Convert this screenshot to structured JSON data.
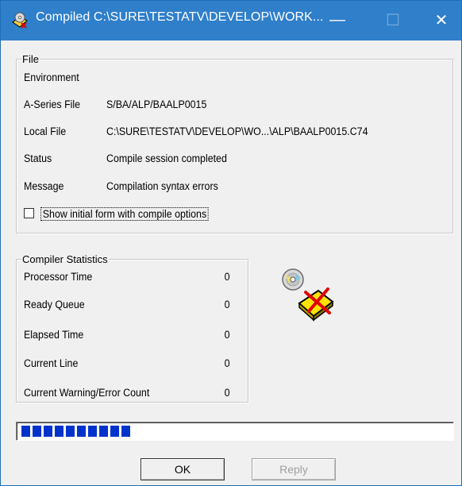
{
  "window": {
    "title": "Compiled C:\\SURE\\TESTATV\\DEVELOP\\WORK...",
    "controls": {
      "minimize": "—",
      "maximize": "☐",
      "close": "✕"
    }
  },
  "file_group": {
    "legend": "File",
    "rows": [
      {
        "label": "Environment",
        "value": ""
      },
      {
        "label": "A-Series File",
        "value": "S/BA/ALP/BAALP0015"
      },
      {
        "label": "Local File",
        "value": "C:\\SURE\\TESTATV\\DEVELOP\\WO...\\ALP\\BAALP0015.C74"
      },
      {
        "label": "Status",
        "value": "Compile session completed"
      },
      {
        "label": "Message",
        "value": "Compilation syntax errors"
      }
    ],
    "show_initial_form": {
      "label": "Show initial form with compile options",
      "checked": false
    }
  },
  "stats_group": {
    "legend": "Compiler Statistics",
    "rows": [
      {
        "label": "Processor Time",
        "value": "0"
      },
      {
        "label": "Ready Queue",
        "value": "0"
      },
      {
        "label": "Elapsed Time",
        "value": "0"
      },
      {
        "label": "Current Line",
        "value": "0"
      },
      {
        "label": "Current Warning/Error Count",
        "value": "0"
      }
    ]
  },
  "progress": {
    "blocks": 10,
    "fraction": 0.26
  },
  "buttons": {
    "ok": "OK",
    "reply": "Reply"
  },
  "colors": {
    "titlebar": "#2f7fcb",
    "progress": "#0033cc"
  }
}
